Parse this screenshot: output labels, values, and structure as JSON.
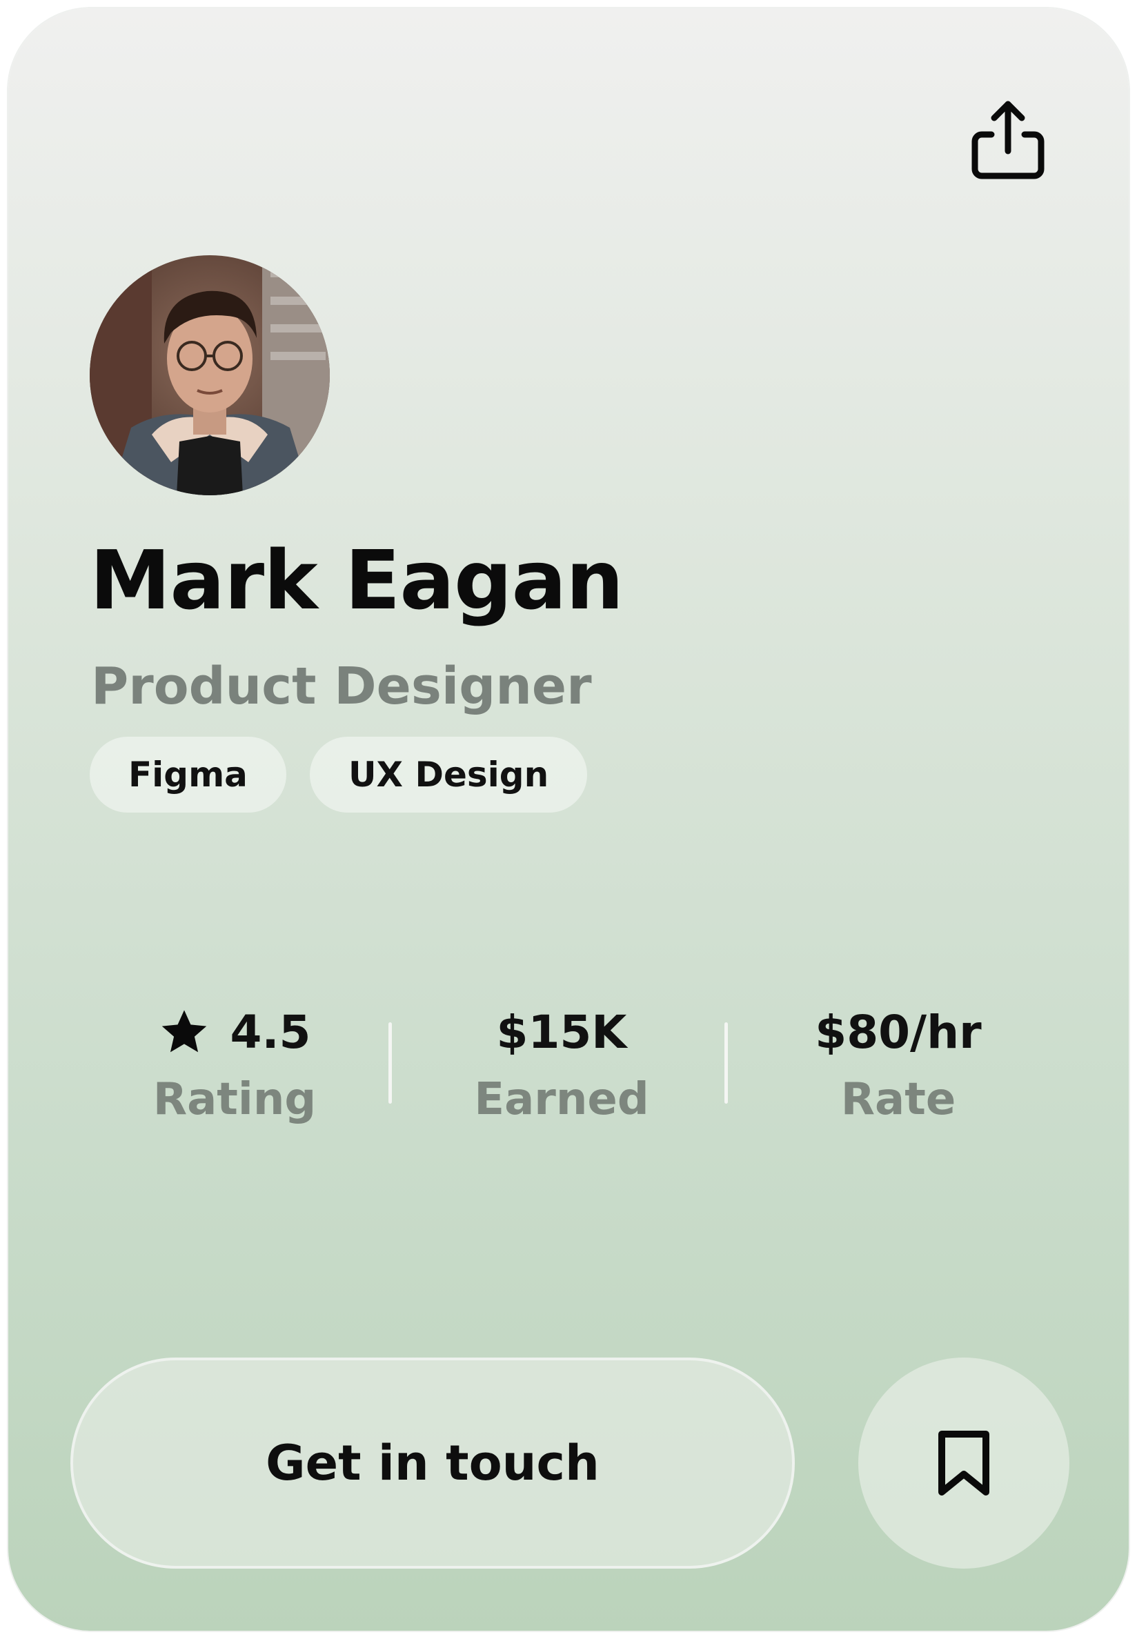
{
  "profile": {
    "name": "Mark Eagan",
    "role": "Product Designer",
    "avatar_alt": "Mark Eagan profile photo",
    "tags": [
      "Figma",
      "UX Design"
    ]
  },
  "stats": {
    "rating": {
      "value": "4.5",
      "label": "Rating",
      "icon": "star-icon"
    },
    "earned": {
      "value": "$15K",
      "label": "Earned"
    },
    "rate": {
      "value": "$80/hr",
      "label": "Rate"
    }
  },
  "actions": {
    "primary_label": "Get in touch",
    "share_icon": "share-icon",
    "bookmark_icon": "bookmark-icon"
  },
  "colors": {
    "card_top": "#f0f0ef",
    "card_bottom": "#bbd3bb",
    "text_primary": "#0b0b0b",
    "text_secondary": "#7a827c"
  }
}
